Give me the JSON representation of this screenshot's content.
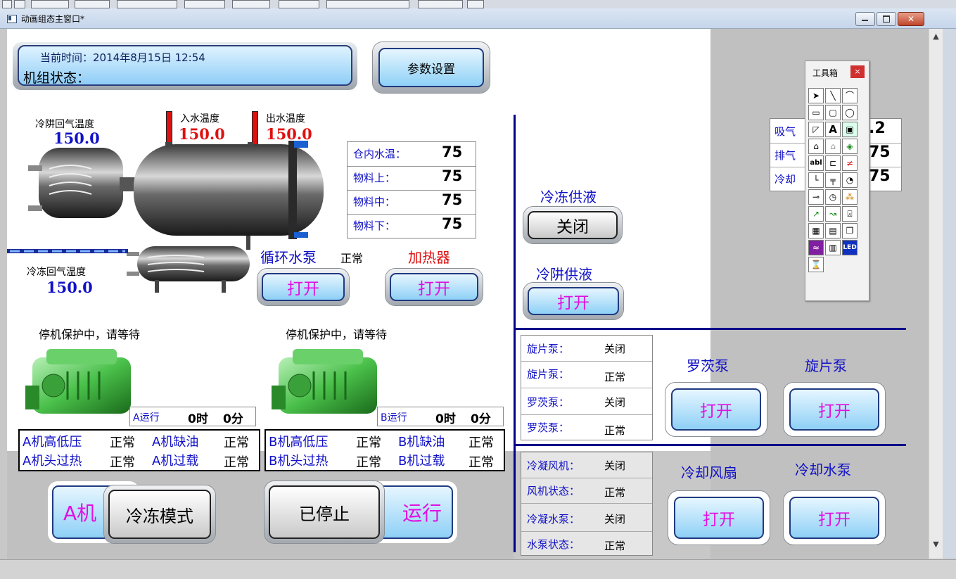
{
  "window": {
    "title": "动画组态主窗口*"
  },
  "header": {
    "time_label": "当前时间：",
    "time_value": "2014年8月15日 12:54",
    "status_label": "机组状态：",
    "settings_button": "参数设置"
  },
  "sensors": {
    "cold_return_air_label": "冷阱回气温度",
    "cold_return_air_value": "150.0",
    "inlet_water_label": "入水温度",
    "inlet_water_value": "150.0",
    "outlet_water_label": "出水温度",
    "outlet_water_value": "150.0",
    "freeze_return_air_label": "冷冻回气温度",
    "freeze_return_air_value": "150.0"
  },
  "temp_table": [
    {
      "label": "仓内水温：",
      "value": "75"
    },
    {
      "label": "物料上：",
      "value": "75"
    },
    {
      "label": "物料中：",
      "value": "75"
    },
    {
      "label": "物料下：",
      "value": "75"
    }
  ],
  "pumps_left": {
    "circ_pump_label": "循环水泵",
    "circ_pump_status": "正常",
    "circ_pump_button": "打开",
    "heater_label": "加热器",
    "heater_button": "打开"
  },
  "compressors": {
    "a_msg": "停机保护中，请等待",
    "b_msg": "停机保护中，请等待",
    "a_run_label": "A运行",
    "a_run_hours": "0时",
    "a_run_mins": "0分",
    "b_run_label": "B运行",
    "b_run_hours": "0时",
    "b_run_mins": "0分"
  },
  "status_grid": {
    "a": [
      {
        "label": "A机高低压",
        "value": "正常"
      },
      {
        "label": "A机缺油",
        "value": "正常"
      },
      {
        "label": "A机头过热",
        "value": "正常"
      },
      {
        "label": "A机过载",
        "value": "正常"
      }
    ],
    "b": [
      {
        "label": "B机高低压",
        "value": "正常"
      },
      {
        "label": "B机缺油",
        "value": "正常"
      },
      {
        "label": "B机头过热",
        "value": "正常"
      },
      {
        "label": "B机过载",
        "value": "正常"
      }
    ]
  },
  "bottom_buttons": {
    "a_machine": "A机",
    "mode": "冷冻模式",
    "stopped": "已停止",
    "run": "运行"
  },
  "supply": {
    "freeze_supply_label": "冷冻供液",
    "freeze_supply_button": "关闭",
    "trap_supply_label": "冷阱供液",
    "trap_supply_button": "打开"
  },
  "vacuum_table": [
    {
      "label": "旋片泵：",
      "value": "关闭"
    },
    {
      "label": "旋片泵：",
      "value": "正常"
    },
    {
      "label": "罗茨泵：",
      "value": "关闭"
    },
    {
      "label": "罗茨泵：",
      "value": "正常"
    }
  ],
  "vacuum_buttons": {
    "roots_label": "罗茨泵",
    "roots_button": "打开",
    "vane_label": "旋片泵",
    "vane_button": "打开"
  },
  "cooling_table": [
    {
      "label": "冷凝风机：",
      "value": "关闭"
    },
    {
      "label": "风机状态：",
      "value": "正常"
    },
    {
      "label": "冷凝水泵：",
      "value": "关闭"
    },
    {
      "label": "水泵状态：",
      "value": "正常"
    }
  ],
  "cooling_buttons": {
    "fan_label": "冷却风扇",
    "fan_button": "打开",
    "pump_label": "冷却水泵",
    "pump_button": "打开"
  },
  "partial_labels": {
    "suction_label": "吸气",
    "suction_value": ".2",
    "exhaust_label": "排气",
    "exhaust_value": "75",
    "coolant_label": "冷却",
    "coolant_value": "75"
  },
  "toolbox": {
    "title": "工具箱",
    "close": "×"
  },
  "colors": {
    "accent_blue": "#1010c8",
    "value_red": "#e01010",
    "button_pink": "#e010e0",
    "divider_navy": "#00008a"
  }
}
